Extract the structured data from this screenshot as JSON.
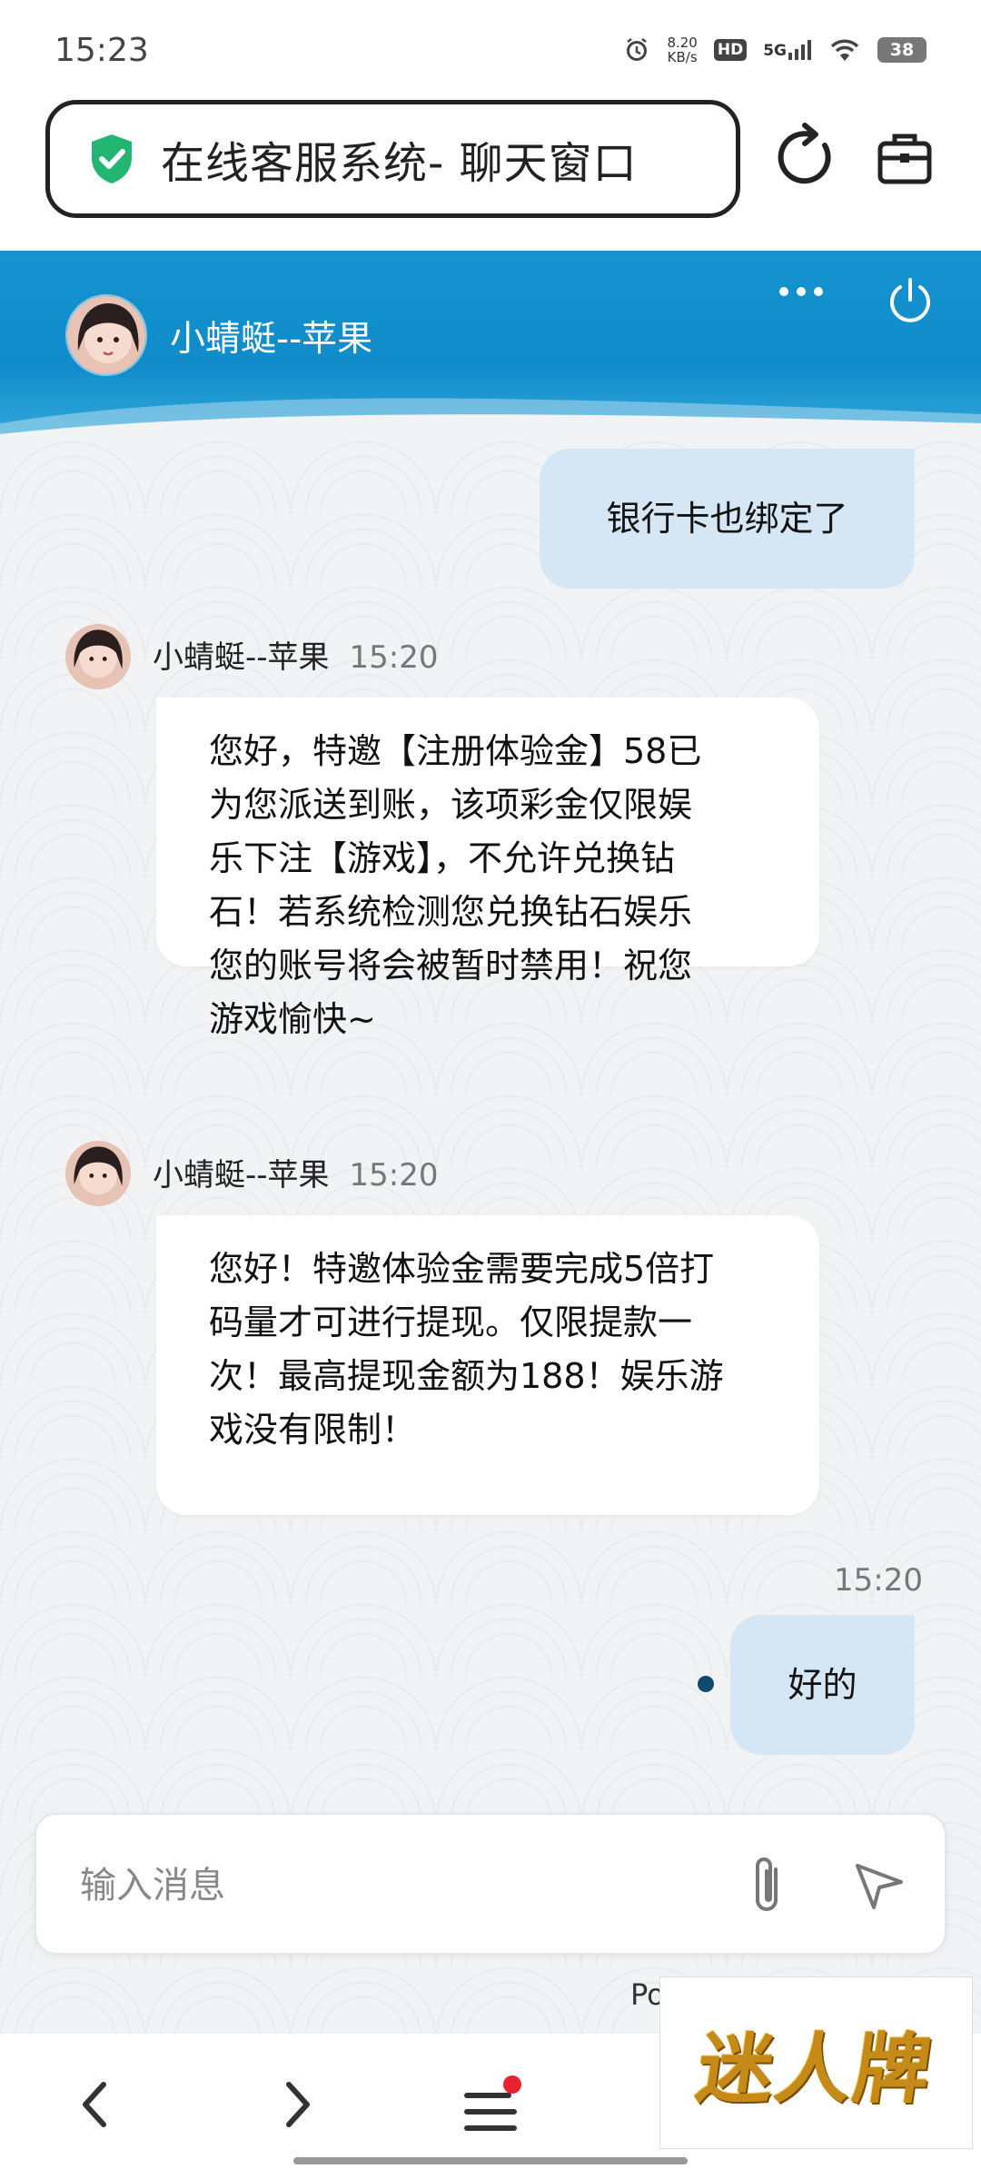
{
  "status_bar": {
    "time": "15:23",
    "net_speed_value": "8.20",
    "net_speed_unit": "KB/s",
    "hd": "HD",
    "network": "5G",
    "battery": "38"
  },
  "browser": {
    "url_title": "在线客服系统- 聊天窗口"
  },
  "chat_header": {
    "agent_name": "小蜻蜓--苹果"
  },
  "messages": [
    {
      "side": "right",
      "text": "银行卡也绑定了"
    },
    {
      "side": "left",
      "sender": "小蜻蜓--苹果",
      "time": "15:20",
      "lines": [
        "您好，特邀【注册体验金】58已",
        "为您派送到账，该项彩金仅限娱",
        "乐下注【游戏】，不允许兑换钻",
        "石！若系统检测您兑换钻石娱乐",
        "您的账号将会被暂时禁用！祝您",
        "游戏愉快~"
      ]
    },
    {
      "side": "left",
      "sender": "小蜻蜓--苹果",
      "time": "15:20",
      "lines": [
        "您好！特邀体验金需要完成5倍打",
        "码量才可进行提现。仅限提款一",
        "次！最高提现金额为188！娱乐游",
        "戏没有限制！"
      ]
    },
    {
      "side": "right",
      "time": "15:20",
      "text": "好的"
    }
  ],
  "input": {
    "placeholder": "输入消息"
  },
  "footer": {
    "powered_partial": "Po"
  },
  "watermark": {
    "text": "迷人牌"
  },
  "colors": {
    "header_blue": "#1593cf",
    "right_bubble": "#d5e7f4",
    "shield_green": "#22b573",
    "notification_dot": "#e8232f"
  },
  "icons": {
    "secure": "shield-check-icon",
    "reload": "reload-icon",
    "toolbox": "toolbox-icon",
    "more": "more-dots-icon",
    "power": "power-icon",
    "attach": "paperclip-icon",
    "send": "send-icon",
    "back": "chevron-left-icon",
    "forward": "chevron-right-icon",
    "menu": "menu-icon"
  }
}
